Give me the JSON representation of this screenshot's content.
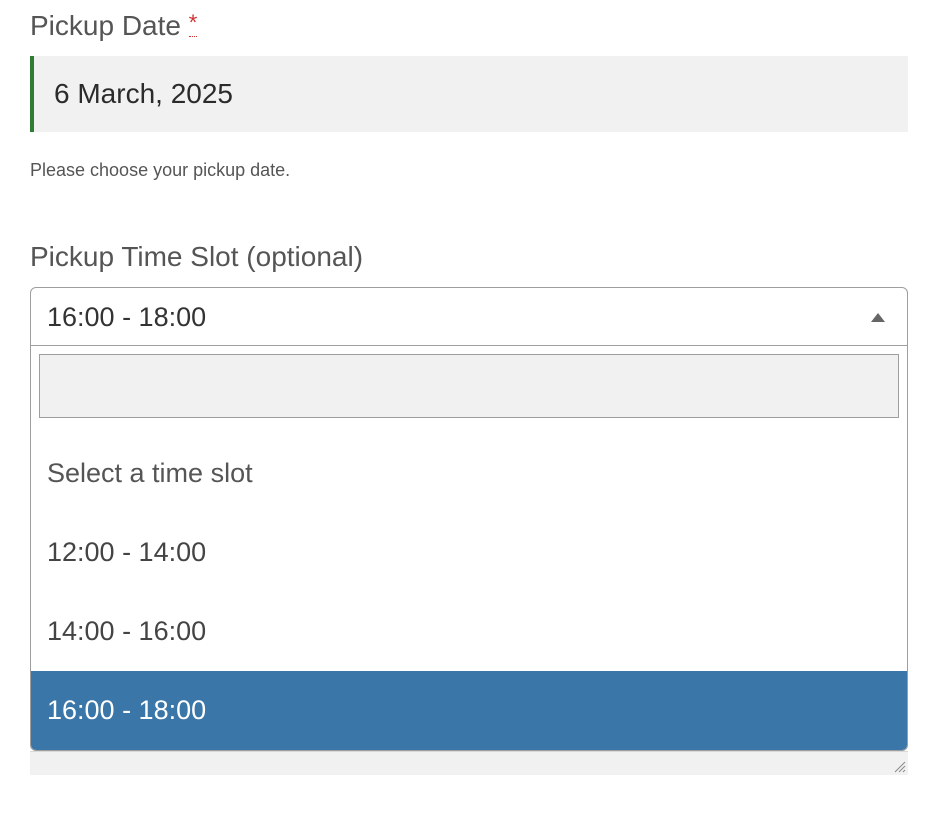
{
  "pickup_date": {
    "label": "Pickup Date",
    "required_mark": "*",
    "value": "6 March, 2025",
    "help": "Please choose your pickup date."
  },
  "pickup_time": {
    "label": "Pickup Time Slot (optional)",
    "selected": "16:00 - 18:00",
    "search_value": "",
    "options": {
      "placeholder": "Select a time slot",
      "opt1": "12:00 - 14:00",
      "opt2": "14:00 - 16:00",
      "opt3": "16:00 - 18:00"
    }
  }
}
